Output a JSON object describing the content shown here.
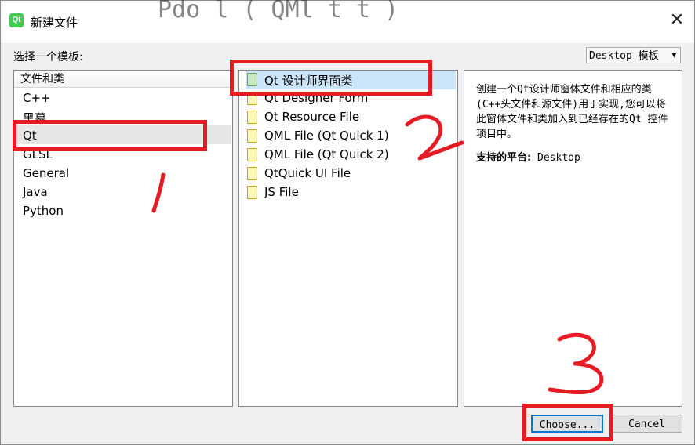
{
  "window": {
    "title": "新建文件",
    "logo_text": "Qt",
    "close_glyph": "✕",
    "background_code_fragment_top": "Pdo l ( QMl t t )",
    "background_code_fragment_left": ")"
  },
  "template_label": "选择一个模板:",
  "filter_combo": {
    "value": "Desktop 模板",
    "arrow": "▼"
  },
  "categories": {
    "header": "文件和类",
    "items": [
      "C++",
      "黑幕",
      "Qt",
      "GLSL",
      "General",
      "Java",
      "Python"
    ],
    "selected": "Qt"
  },
  "files": {
    "items": [
      "Qt 设计师界面类",
      "Qt Designer Form",
      "Qt Resource File",
      "QML File (Qt Quick 1)",
      "QML File (Qt Quick 2)",
      "QtQuick UI File",
      "JS File"
    ],
    "selected": "Qt 设计师界面类"
  },
  "description": {
    "text": "创建一个Qt设计师窗体文件和相应的类(C++头文件和源文件)用于实现,您可以将此窗体文件和类加入到已经存在的Qt 控件项目中。",
    "platform_label": "支持的平台:",
    "platform_value": "Desktop"
  },
  "buttons": {
    "choose": "Choose...",
    "cancel": "Cancel"
  },
  "annotations": {
    "color": "#e51c23",
    "marks": [
      "1",
      "2",
      "3"
    ]
  }
}
